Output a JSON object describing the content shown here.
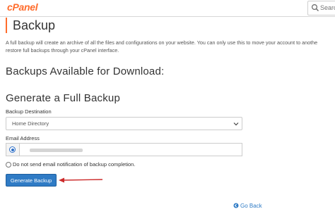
{
  "header": {
    "logo_text": "cPanel",
    "search_placeholder": "Search"
  },
  "page": {
    "title": "Backup",
    "intro_line1": "A full backup will create an archive of all the files and configurations on your website. You can only use this to move your account to anothe",
    "intro_line2": "restore full backups through your cPanel interface."
  },
  "available": {
    "heading": "Backups Available for Download:"
  },
  "generate": {
    "heading": "Generate a Full Backup",
    "destination_label": "Backup Destination",
    "destination_value": "Home Directory",
    "email_label": "Email Address",
    "email_value": "",
    "no_notify_label": "Do not send email notification of backup completion.",
    "button_label": "Generate Backup"
  },
  "footer": {
    "go_back_label": "Go Back"
  },
  "colors": {
    "brand": "#ff6c2c",
    "primary_button": "#2f7bc5",
    "annotation_arrow": "#cc2a2a"
  }
}
